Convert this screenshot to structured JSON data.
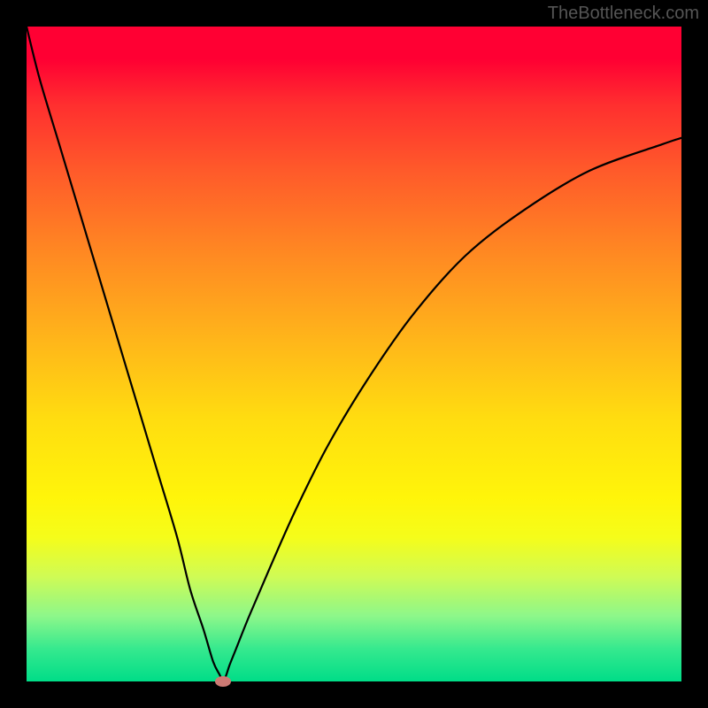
{
  "watermark": "TheBottleneck.com",
  "chart_data": {
    "type": "line",
    "title": "",
    "xlabel": "",
    "ylabel": "",
    "xlim": [
      0,
      100
    ],
    "ylim": [
      0,
      100
    ],
    "grid": false,
    "legend": false,
    "background_gradient": {
      "top_color": "#ff0033",
      "bottom_color": "#00dd88",
      "meaning": "red (bottleneck) to green (no bottleneck)"
    },
    "series": [
      {
        "name": "bottleneck-curve",
        "color": "#000000",
        "x": [
          0,
          2,
          5,
          8,
          11,
          14,
          17,
          20,
          23,
          25,
          27,
          28.5,
          29.5,
          30,
          30.5,
          31,
          32,
          34,
          37,
          41,
          46,
          52,
          59,
          67,
          76,
          86,
          97,
          100
        ],
        "values": [
          100,
          92,
          82,
          72,
          62,
          52,
          42,
          32,
          22,
          14,
          8,
          3,
          1,
          0,
          1,
          2.5,
          5,
          10,
          17,
          26,
          36,
          46,
          56,
          65,
          72,
          78,
          82,
          83
        ]
      }
    ],
    "marker": {
      "x": 30,
      "y": 0,
      "color": "#cc7a74",
      "meaning": "optimal point (minimum bottleneck)"
    }
  }
}
